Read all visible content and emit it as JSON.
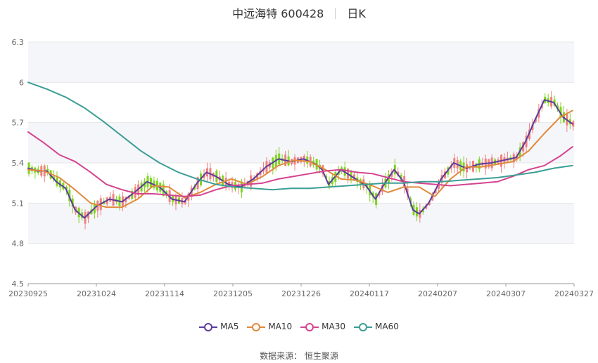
{
  "header": {
    "stock_name": "中远海特 600428",
    "period": "日K"
  },
  "source": {
    "label": "数据来源：",
    "value": "恒生聚源"
  },
  "chart_data": {
    "type": "candlestick",
    "title": "中远海特 600428",
    "subtitle": "日K",
    "x_ticks": [
      "20230925",
      "20231024",
      "20231114",
      "20231205",
      "20231226",
      "20240117",
      "20240207",
      "20240307",
      "20240327"
    ],
    "ylim": [
      4.5,
      6.3
    ],
    "y_ticks": [
      4.5,
      4.8,
      5.1,
      5.4,
      5.7,
      6,
      6.3
    ],
    "grid": true,
    "legend_position": "bottom",
    "up_color": "#f08080",
    "down_color": "#7ed321",
    "series": [
      {
        "name": "MA5",
        "color": "#5b3c9c",
        "values": [
          [
            0,
            5.36
          ],
          [
            6,
            5.34
          ],
          [
            12,
            5.34
          ],
          [
            18,
            5.26
          ],
          [
            24,
            5.21
          ],
          [
            30,
            5.05
          ],
          [
            36,
            4.99
          ],
          [
            44,
            5.08
          ],
          [
            52,
            5.13
          ],
          [
            60,
            5.11
          ],
          [
            68,
            5.18
          ],
          [
            76,
            5.26
          ],
          [
            84,
            5.22
          ],
          [
            92,
            5.13
          ],
          [
            100,
            5.11
          ],
          [
            108,
            5.25
          ],
          [
            114,
            5.33
          ],
          [
            120,
            5.3
          ],
          [
            128,
            5.24
          ],
          [
            136,
            5.22
          ],
          [
            144,
            5.28
          ],
          [
            152,
            5.37
          ],
          [
            160,
            5.43
          ],
          [
            168,
            5.41
          ],
          [
            176,
            5.43
          ],
          [
            184,
            5.39
          ],
          [
            188,
            5.35
          ],
          [
            192,
            5.24
          ],
          [
            200,
            5.35
          ],
          [
            208,
            5.29
          ],
          [
            216,
            5.23
          ],
          [
            222,
            5.13
          ],
          [
            228,
            5.25
          ],
          [
            234,
            5.35
          ],
          [
            240,
            5.26
          ],
          [
            246,
            5.05
          ],
          [
            250,
            5.02
          ],
          [
            256,
            5.1
          ],
          [
            264,
            5.28
          ],
          [
            272,
            5.4
          ],
          [
            280,
            5.36
          ],
          [
            288,
            5.39
          ],
          [
            296,
            5.4
          ],
          [
            304,
            5.42
          ],
          [
            312,
            5.44
          ],
          [
            318,
            5.56
          ],
          [
            324,
            5.72
          ],
          [
            330,
            5.87
          ],
          [
            336,
            5.85
          ],
          [
            342,
            5.74
          ],
          [
            348,
            5.69
          ]
        ]
      },
      {
        "name": "MA10",
        "color": "#e08a3b",
        "values": [
          [
            0,
            5.35
          ],
          [
            10,
            5.34
          ],
          [
            20,
            5.29
          ],
          [
            30,
            5.2
          ],
          [
            40,
            5.1
          ],
          [
            50,
            5.07
          ],
          [
            60,
            5.07
          ],
          [
            70,
            5.13
          ],
          [
            80,
            5.23
          ],
          [
            90,
            5.22
          ],
          [
            100,
            5.14
          ],
          [
            110,
            5.18
          ],
          [
            120,
            5.24
          ],
          [
            130,
            5.28
          ],
          [
            140,
            5.24
          ],
          [
            150,
            5.3
          ],
          [
            160,
            5.38
          ],
          [
            170,
            5.42
          ],
          [
            180,
            5.41
          ],
          [
            190,
            5.35
          ],
          [
            200,
            5.28
          ],
          [
            210,
            5.27
          ],
          [
            220,
            5.23
          ],
          [
            230,
            5.18
          ],
          [
            240,
            5.22
          ],
          [
            250,
            5.22
          ],
          [
            260,
            5.15
          ],
          [
            270,
            5.28
          ],
          [
            280,
            5.37
          ],
          [
            290,
            5.37
          ],
          [
            300,
            5.39
          ],
          [
            310,
            5.41
          ],
          [
            320,
            5.49
          ],
          [
            330,
            5.62
          ],
          [
            340,
            5.74
          ],
          [
            348,
            5.79
          ]
        ]
      },
      {
        "name": "MA30",
        "color": "#d4448f",
        "values": [
          [
            0,
            5.63
          ],
          [
            10,
            5.55
          ],
          [
            20,
            5.46
          ],
          [
            30,
            5.41
          ],
          [
            40,
            5.33
          ],
          [
            50,
            5.24
          ],
          [
            60,
            5.2
          ],
          [
            70,
            5.17
          ],
          [
            80,
            5.17
          ],
          [
            90,
            5.16
          ],
          [
            100,
            5.15
          ],
          [
            110,
            5.16
          ],
          [
            120,
            5.2
          ],
          [
            130,
            5.23
          ],
          [
            140,
            5.24
          ],
          [
            150,
            5.25
          ],
          [
            160,
            5.28
          ],
          [
            170,
            5.3
          ],
          [
            180,
            5.32
          ],
          [
            190,
            5.34
          ],
          [
            200,
            5.35
          ],
          [
            210,
            5.33
          ],
          [
            220,
            5.32
          ],
          [
            230,
            5.29
          ],
          [
            240,
            5.26
          ],
          [
            250,
            5.25
          ],
          [
            260,
            5.24
          ],
          [
            270,
            5.23
          ],
          [
            280,
            5.24
          ],
          [
            290,
            5.25
          ],
          [
            300,
            5.26
          ],
          [
            310,
            5.3
          ],
          [
            320,
            5.35
          ],
          [
            330,
            5.38
          ],
          [
            340,
            5.45
          ],
          [
            348,
            5.52
          ]
        ]
      },
      {
        "name": "MA60",
        "color": "#3c9e95",
        "values": [
          [
            0,
            6.0
          ],
          [
            12,
            5.95
          ],
          [
            24,
            5.89
          ],
          [
            36,
            5.81
          ],
          [
            48,
            5.71
          ],
          [
            60,
            5.6
          ],
          [
            72,
            5.49
          ],
          [
            84,
            5.4
          ],
          [
            96,
            5.33
          ],
          [
            108,
            5.28
          ],
          [
            120,
            5.24
          ],
          [
            132,
            5.22
          ],
          [
            144,
            5.21
          ],
          [
            156,
            5.2
          ],
          [
            168,
            5.21
          ],
          [
            180,
            5.21
          ],
          [
            192,
            5.22
          ],
          [
            204,
            5.23
          ],
          [
            216,
            5.24
          ],
          [
            228,
            5.25
          ],
          [
            240,
            5.25
          ],
          [
            252,
            5.26
          ],
          [
            264,
            5.26
          ],
          [
            276,
            5.27
          ],
          [
            288,
            5.28
          ],
          [
            300,
            5.29
          ],
          [
            312,
            5.31
          ],
          [
            324,
            5.33
          ],
          [
            336,
            5.36
          ],
          [
            348,
            5.38
          ]
        ]
      }
    ]
  }
}
